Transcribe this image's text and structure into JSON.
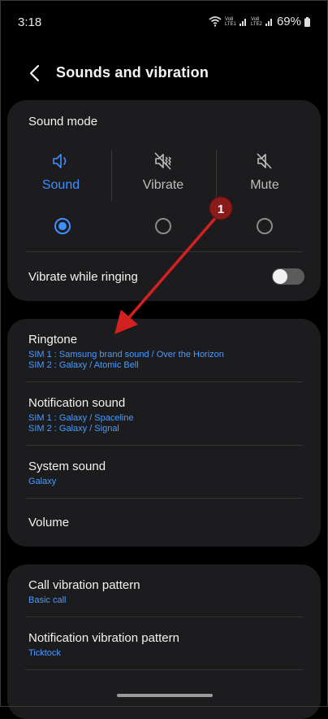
{
  "status": {
    "time": "3:18",
    "battery": "69%",
    "sim1": "Vo8 LTE1",
    "sim2": "Vo8 LTE2"
  },
  "header": {
    "title": "Sounds and vibration"
  },
  "sound_mode": {
    "title": "Sound mode",
    "modes": [
      {
        "label": "Sound",
        "selected": true
      },
      {
        "label": "Vibrate",
        "selected": false
      },
      {
        "label": "Mute",
        "selected": false
      }
    ],
    "vibrate_while_ringing": {
      "label": "Vibrate while ringing",
      "on": false
    }
  },
  "sounds": {
    "ringtone": {
      "label": "Ringtone",
      "sim1": "SIM 1 : Samsung brand sound / Over the Horizon",
      "sim2": "SIM 2 : Galaxy / Atomic Bell"
    },
    "notification": {
      "label": "Notification sound",
      "sim1": "SIM 1 : Galaxy / Spaceline",
      "sim2": "SIM 2 : Galaxy / Signal"
    },
    "system": {
      "label": "System sound",
      "value": "Galaxy"
    },
    "volume": {
      "label": "Volume"
    }
  },
  "vibration": {
    "call": {
      "label": "Call vibration pattern",
      "value": "Basic call"
    },
    "notification": {
      "label": "Notification vibration pattern",
      "value": "Ticktock"
    }
  },
  "annotation": {
    "badge": "1"
  },
  "colors": {
    "accent": "#3e8fff",
    "annotation": "#d32020",
    "badge": "#8b1a1a"
  }
}
